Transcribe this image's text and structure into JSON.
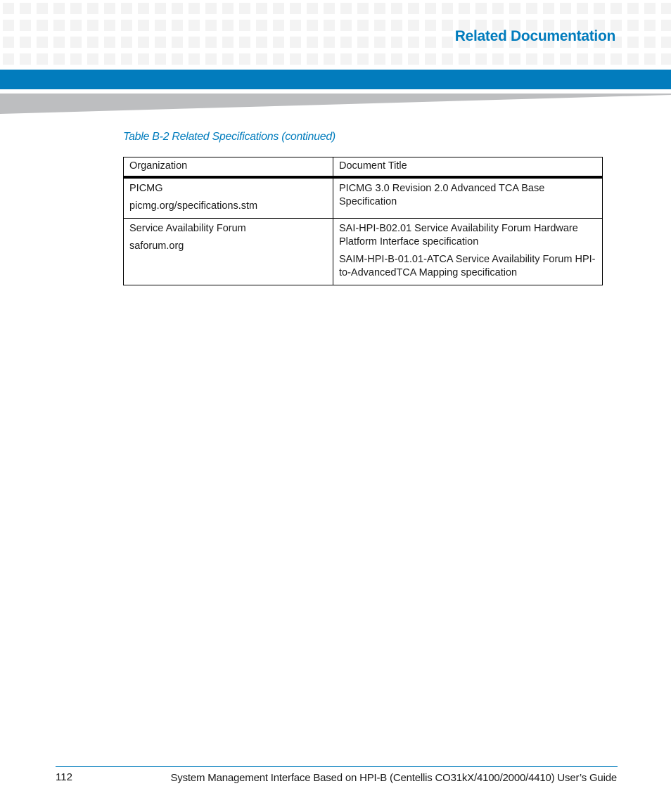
{
  "header": {
    "section_title": "Related Documentation",
    "brand_color": "#017cbd"
  },
  "table": {
    "caption": "Table B-2 Related Specifications (continued)",
    "columns": [
      "Organization",
      "Document Title"
    ],
    "rows": [
      {
        "organization": [
          "PICMG",
          "picmg.org/specifications.stm"
        ],
        "documents": [
          "PICMG 3.0 Revision 2.0 Advanced TCA Base Specification"
        ]
      },
      {
        "organization": [
          "Service Availability Forum",
          "saforum.org"
        ],
        "documents": [
          "SAI-HPI-B02.01 Service Availability Forum Hardware Platform Interface specification",
          "SAIM-HPI-B-01.01-ATCA Service Availability Forum HPI-to-AdvancedTCA Mapping specification"
        ]
      }
    ]
  },
  "footer": {
    "page_number": "112",
    "document_title": "System Management Interface Based on HPI-B (Centellis CO31kX/4100/2000/4410) User’s Guide"
  }
}
